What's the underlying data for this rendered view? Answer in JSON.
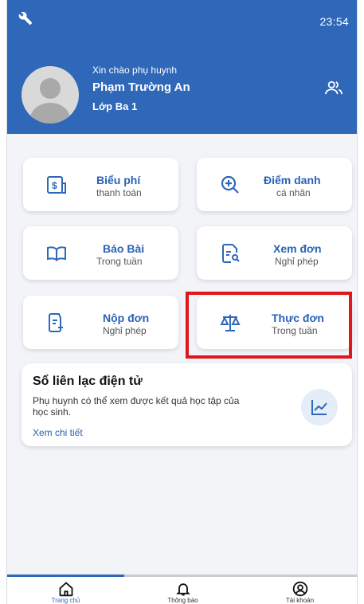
{
  "status_bar": {
    "time": "23:54"
  },
  "header": {
    "greeting": "Xin chào phụ huynh",
    "student_name": "Phạm Trường An",
    "class_name": "Lớp Ba 1"
  },
  "menu": [
    {
      "title": "Biểu phí",
      "subtitle": "thanh toán",
      "icon": "fee-icon"
    },
    {
      "title": "Điểm danh",
      "subtitle": "cá nhân",
      "icon": "attendance-icon"
    },
    {
      "title": "Báo Bài",
      "subtitle": "Trong tuần",
      "icon": "book-icon"
    },
    {
      "title": "Xem đơn",
      "subtitle": "Nghỉ phép",
      "icon": "view-form-icon"
    },
    {
      "title": "Nộp đơn",
      "subtitle": "Nghỉ phép",
      "icon": "submit-form-icon"
    },
    {
      "title": "Thực đơn",
      "subtitle": "Trong tuần",
      "icon": "scale-icon"
    }
  ],
  "info_card": {
    "title": "Sổ liên lạc điện tử",
    "description": "Phụ huynh có thể xem được kết quả học tập của học sinh.",
    "link": "Xem chi tiết"
  },
  "bottom_nav": [
    {
      "label": "Trang chủ",
      "icon": "home-icon",
      "active": true
    },
    {
      "label": "Thông báo",
      "icon": "bell-icon",
      "active": false
    },
    {
      "label": "Tài khoản",
      "icon": "account-icon",
      "active": false
    }
  ],
  "colors": {
    "primary": "#2f67b9",
    "highlight": "#e0161c",
    "background": "#f2f4f8"
  }
}
